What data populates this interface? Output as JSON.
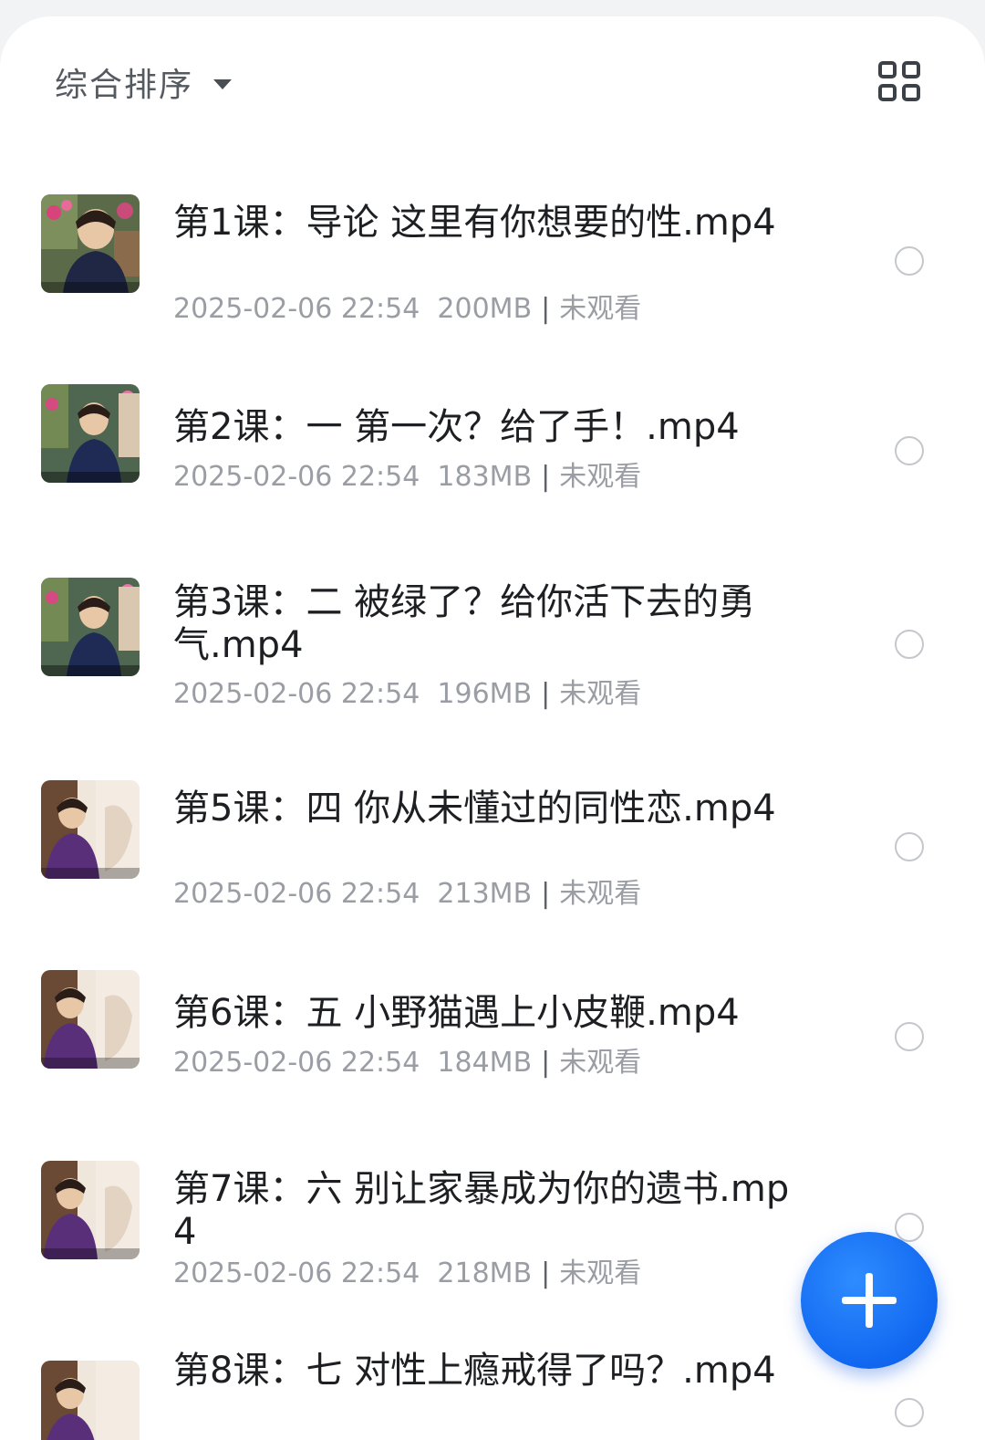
{
  "toolbar": {
    "sort_label": "综合排序",
    "sort_icon": "caret-down-icon",
    "view_toggle_icon": "grid-view-icon"
  },
  "videos": [
    {
      "title": "第1课：导论 这里有你想要的性.mp4",
      "date": "2025-02-06 22:54",
      "size": "200MB",
      "status": "未观看",
      "thumb_scene": "garden"
    },
    {
      "title": "第2课：一 第一次？给了手！.mp4",
      "date": "2025-02-06 22:54",
      "size": "183MB",
      "status": "未观看",
      "thumb_scene": "garden"
    },
    {
      "title": "第3课：二 被绿了？给你活下去的勇气.mp4",
      "date": "2025-02-06 22:54",
      "size": "196MB",
      "status": "未观看",
      "thumb_scene": "garden"
    },
    {
      "title": "第5课：四 你从未懂过的同性恋.mp4",
      "date": "2025-02-06 22:54",
      "size": "213MB",
      "status": "未观看",
      "thumb_scene": "living-room"
    },
    {
      "title": "第6课：五 小野猫遇上小皮鞭.mp4",
      "date": "2025-02-06 22:54",
      "size": "184MB",
      "status": "未观看",
      "thumb_scene": "living-room"
    },
    {
      "title": "第7课：六 别让家暴成为你的遗书.mp4",
      "date": "2025-02-06 22:54",
      "size": "218MB",
      "status": "未观看",
      "thumb_scene": "living-room"
    },
    {
      "title": "第8课：七 对性上瘾戒得了吗？.mp4",
      "date": "",
      "size": "",
      "status": "",
      "thumb_scene": "living-room"
    }
  ],
  "fab": {
    "icon": "plus-icon"
  },
  "colors": {
    "accent": "#1168f0",
    "title_text": "#1d1f22",
    "meta_text": "#9a9ea4",
    "background": "#ffffff"
  }
}
